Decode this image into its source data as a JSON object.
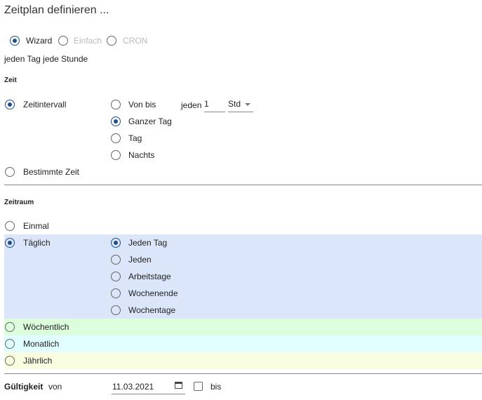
{
  "title": "Zeitplan definieren ...",
  "modes": {
    "wizard": "Wizard",
    "einfach": "Einfach",
    "cron": "CRON"
  },
  "summary": "jeden Tag jede Stunde",
  "zeit": {
    "heading": "Zeit",
    "zeitintervall": "Zeitintervall",
    "bestimmte": "Bestimmte Zeit",
    "options": [
      "Von bis",
      "Ganzer Tag",
      "Tag",
      "Nachts"
    ],
    "jeden_label": "jeden",
    "jeden_value": "1",
    "unit": "Std"
  },
  "zeitraum": {
    "heading": "Zeitraum",
    "einmal": "Einmal",
    "taeglich": "Täglich",
    "daily_options": [
      "Jeden Tag",
      "Jeden",
      "Arbeitstage",
      "Wochenende",
      "Wochentage"
    ],
    "woechentlich": "Wöchentlich",
    "monatlich": "Monatlich",
    "jaehrlich": "Jährlich"
  },
  "gueltigkeit": {
    "label": "Gültigkeit",
    "von": "von",
    "date": "11.03.2021",
    "bis": "bis"
  },
  "colors": {
    "accent": "#1f4e8c",
    "daily": "#dce6fb",
    "weekly": "#ddfedd",
    "monthly": "#e0feff",
    "yearly": "#fafee0"
  }
}
